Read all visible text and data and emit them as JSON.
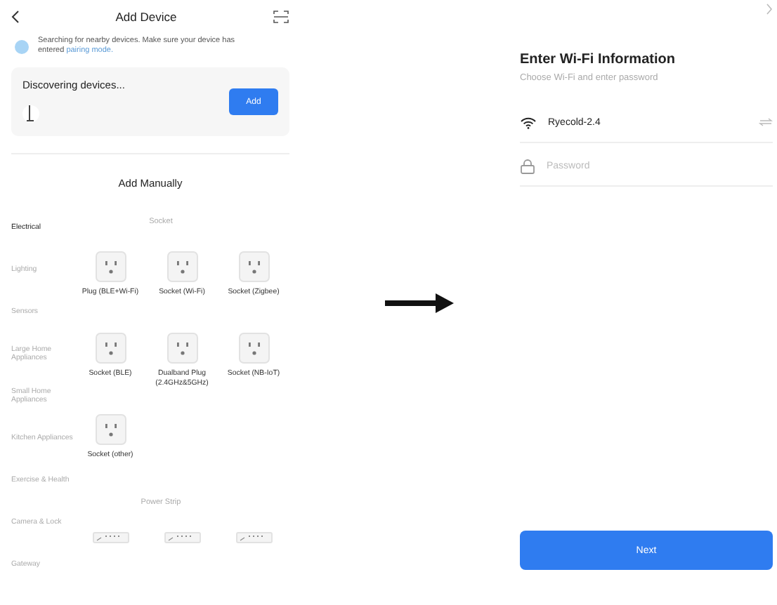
{
  "left_screen": {
    "title": "Add Device",
    "notice": "Searching for nearby devices. Make sure your device has entered",
    "notice_link": "pairing mode.",
    "discovery": {
      "title": "Discovering devices...",
      "button": "Add"
    },
    "manual_title": "Add Manually",
    "categories": [
      {
        "label": "Electrical",
        "selected": true
      },
      {
        "label": "Lighting",
        "selected": false
      },
      {
        "label": "Sensors",
        "selected": false
      },
      {
        "label": "Large Home Appliances",
        "selected": false
      },
      {
        "label": "Small Home Appliances",
        "selected": false
      },
      {
        "label": "Kitchen Appliances",
        "selected": false
      },
      {
        "label": "Exercise & Health",
        "selected": false
      },
      {
        "label": "Camera & Lock",
        "selected": false
      },
      {
        "label": "Gateway",
        "selected": false
      }
    ],
    "sections": [
      {
        "title": "Socket",
        "devices": [
          {
            "kind": "socket",
            "name": "Plug (BLE+Wi-Fi)"
          },
          {
            "kind": "socket",
            "name": "Socket (Wi-Fi)"
          },
          {
            "kind": "socket",
            "name": "Socket (Zigbee)"
          },
          {
            "kind": "socket",
            "name": "Socket (BLE)"
          },
          {
            "kind": "socket",
            "name": "Dualband Plug (2.4GHz&5GHz)"
          },
          {
            "kind": "socket",
            "name": "Socket (NB-IoT)"
          },
          {
            "kind": "socket",
            "name": "Socket (other)"
          }
        ]
      },
      {
        "title": "Power Strip",
        "devices": [
          {
            "kind": "strip"
          },
          {
            "kind": "strip"
          },
          {
            "kind": "strip"
          }
        ]
      }
    ]
  },
  "right_screen": {
    "title": "Enter Wi-Fi Information",
    "subtitle": "Choose Wi-Fi and enter password",
    "network": "Ryecold-2.4",
    "password": {
      "placeholder": "Password"
    },
    "button": "Next"
  }
}
